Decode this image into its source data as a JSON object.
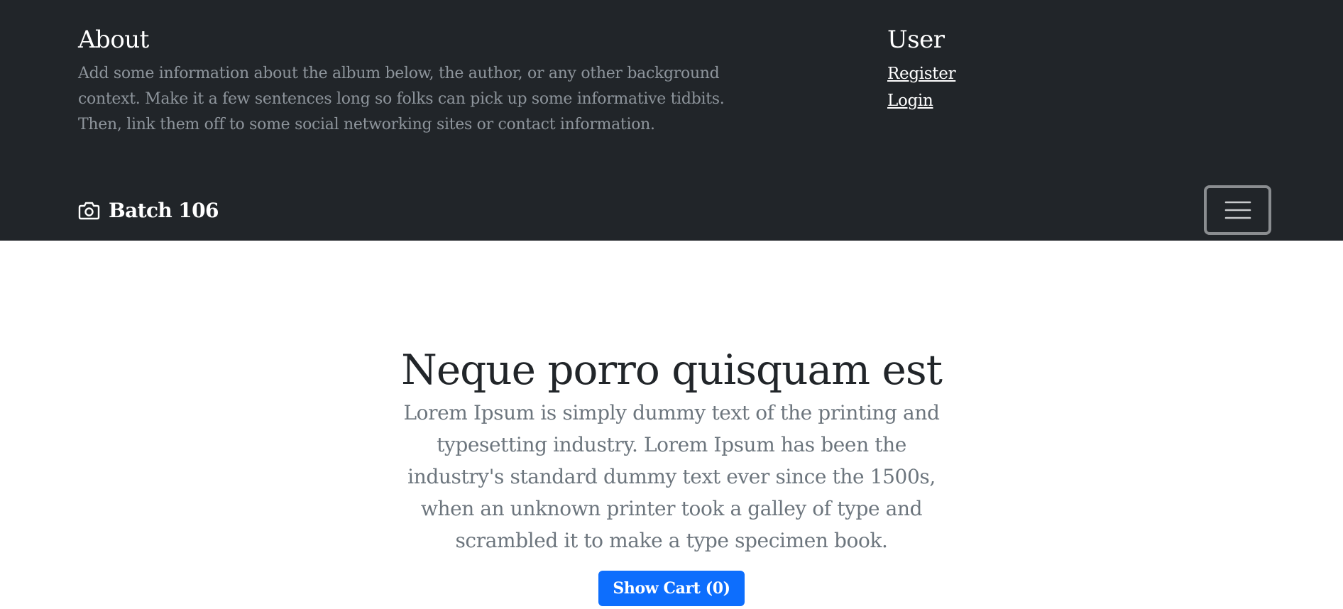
{
  "header": {
    "about": {
      "title": "About",
      "text": "Add some information about the album below, the author, or any other background context. Make it a few sentences long so folks can pick up some informative tidbits. Then, link them off to some social networking sites or contact information."
    },
    "user": {
      "title": "User",
      "links": [
        {
          "label": "Register"
        },
        {
          "label": "Login"
        }
      ]
    }
  },
  "navbar": {
    "brand_label": "Batch 106",
    "brand_icon": "camera-icon",
    "toggler_icon": "hamburger-menu-icon"
  },
  "hero": {
    "title": "Neque porro quisquam est",
    "text": "Lorem Ipsum is simply dummy text of the printing and typesetting industry. Lorem Ipsum has been the industry's standard dummy text ever since the 1500s, when an unknown printer took a galley of type and scrambled it to make a type specimen book.",
    "cart_button_label": "Show Cart (0)"
  },
  "colors": {
    "header_bg": "#212529",
    "muted_text": "#8e959c",
    "primary": "#0d6efd"
  }
}
